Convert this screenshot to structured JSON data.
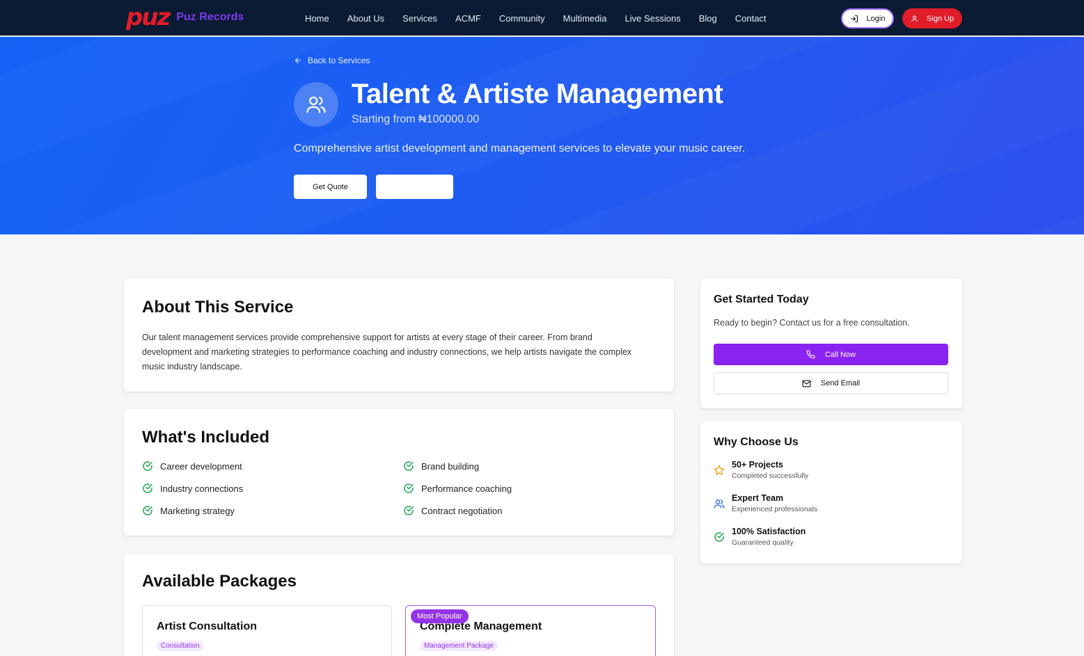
{
  "brand": {
    "mark": "puz",
    "name": "Puz Records"
  },
  "nav": {
    "links": [
      "Home",
      "About Us",
      "Services",
      "ACMF",
      "Community",
      "Multimedia",
      "Live Sessions",
      "Blog",
      "Contact"
    ],
    "login_label": "Login",
    "signup_label": "Sign Up"
  },
  "hero": {
    "back_label": "Back to Services",
    "title": "Talent & Artiste Management",
    "price": "Starting from ₦100000.00",
    "description": "Comprehensive artist development and management services to elevate your music career.",
    "quote_label": "Get Quote",
    "secondary_label": ""
  },
  "about": {
    "title": "About This Service",
    "body": "Our talent management services provide comprehensive support for artists at every stage of their career. From brand development and marketing strategies to performance coaching and industry connections, we help artists navigate the complex music industry landscape."
  },
  "included": {
    "title": "What's Included",
    "items": [
      "Career development",
      "Brand building",
      "Industry connections",
      "Performance coaching",
      "Marketing strategy",
      "Contract negotiation"
    ]
  },
  "packages": {
    "title": "Available Packages",
    "items": [
      {
        "name": "Artist Consultation",
        "tag": "Consultation",
        "badge": ""
      },
      {
        "name": "Complete Management",
        "tag": "Management Package",
        "badge": "Most Popular"
      }
    ]
  },
  "get_started": {
    "title": "Get Started Today",
    "text": "Ready to begin? Contact us for a free consultation.",
    "call_label": "Call Now",
    "email_label": "Send Email"
  },
  "why": {
    "title": "Why Choose Us",
    "items": [
      {
        "title": "50+ Projects",
        "sub": "Completed successfully",
        "icon": "star-icon"
      },
      {
        "title": "Expert Team",
        "sub": "Experienced professionals",
        "icon": "users-icon"
      },
      {
        "title": "100% Satisfaction",
        "sub": "Guaranteed quality",
        "icon": "check-circle-icon"
      }
    ]
  },
  "colors": {
    "nav_bg": "#0a1b33",
    "hero_blue": "#1f5cf2",
    "brand_red": "#e11d2a",
    "brand_purple": "#8b23f0",
    "check_green": "#16a34a"
  }
}
